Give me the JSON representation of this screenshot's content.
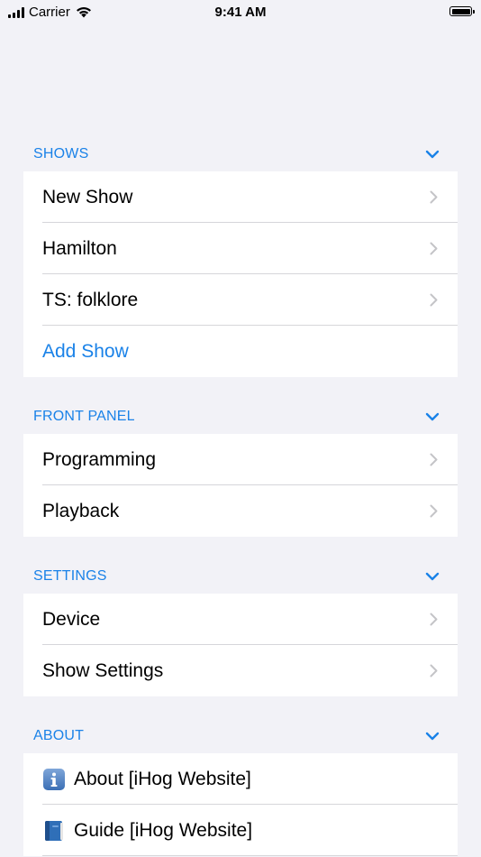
{
  "status_bar": {
    "carrier": "Carrier",
    "time": "9:41 AM"
  },
  "colors": {
    "accent": "#1a82e8",
    "background": "#f2f2f7",
    "cell": "#ffffff",
    "separator": "#d6d6da",
    "chevron": "#c4c4c7"
  },
  "sections": {
    "shows": {
      "title": "SHOWS",
      "items": [
        "New Show",
        "Hamilton",
        "TS: folklore"
      ],
      "add_label": "Add Show"
    },
    "front_panel": {
      "title": "FRONT PANEL",
      "items": [
        "Programming",
        "Playback"
      ]
    },
    "settings": {
      "title": "SETTINGS",
      "items": [
        "Device",
        "Show Settings"
      ]
    },
    "about": {
      "title": "ABOUT",
      "items": [
        {
          "icon": "info-icon",
          "label": "About [iHog Website]"
        },
        {
          "icon": "book-icon",
          "label": "Guide [iHog Website]"
        }
      ]
    }
  }
}
